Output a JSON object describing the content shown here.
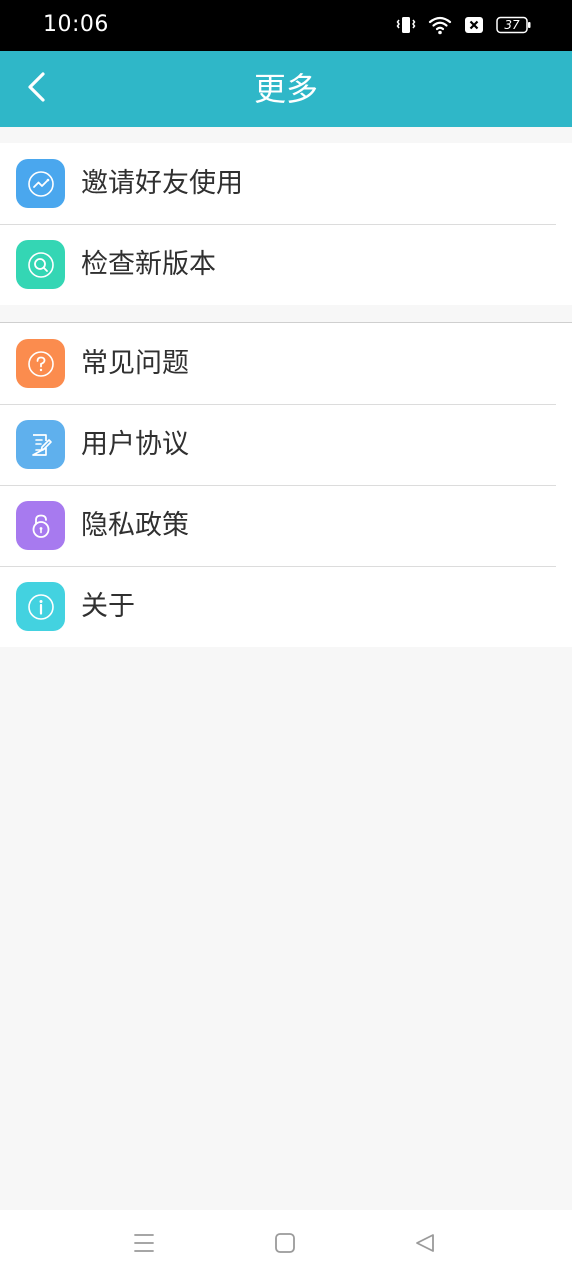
{
  "status_bar": {
    "time": "10:06",
    "battery_level": "37"
  },
  "header": {
    "title": "更多",
    "background_color": "#2fb7c8"
  },
  "groups": [
    {
      "items": [
        {
          "label": "邀请好友使用",
          "icon": "share-chart-icon",
          "icon_color": "#4aa7ee"
        },
        {
          "label": "检查新版本",
          "icon": "search-icon",
          "icon_color": "#34d6b4"
        }
      ]
    },
    {
      "items": [
        {
          "label": "常见问题",
          "icon": "question-icon",
          "icon_color": "#fb8c4e"
        },
        {
          "label": "用户协议",
          "icon": "agreement-edit-icon",
          "icon_color": "#5fb0ed"
        },
        {
          "label": "隐私政策",
          "icon": "unlock-icon",
          "icon_color": "#a77aef"
        },
        {
          "label": "关于",
          "icon": "info-icon",
          "icon_color": "#43d2e0"
        }
      ]
    }
  ],
  "nav_bar": {
    "buttons": [
      "menu-icon",
      "home-icon",
      "back-triangle-icon"
    ]
  }
}
